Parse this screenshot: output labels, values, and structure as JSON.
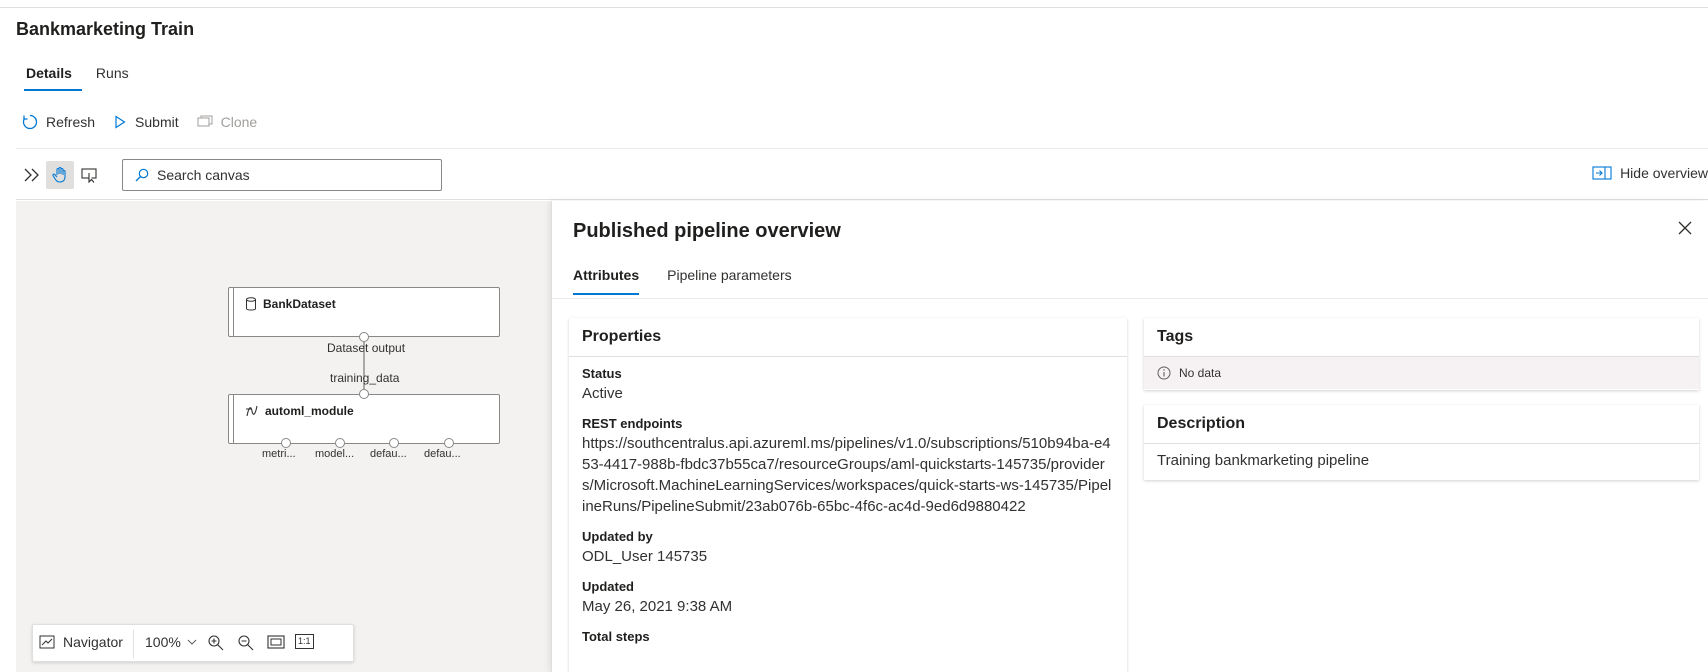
{
  "page": {
    "title": "Bankmarketing Train"
  },
  "tabs": [
    {
      "label": "Details",
      "active": true
    },
    {
      "label": "Runs",
      "active": false
    }
  ],
  "toolbar": {
    "refresh_label": "Refresh",
    "submit_label": "Submit",
    "clone_label": "Clone"
  },
  "canvas_toolbar": {
    "search_placeholder": "Search canvas",
    "hide_overview_label": "Hide overview"
  },
  "canvas": {
    "nodes": [
      {
        "title": "BankDataset",
        "icon": "database-icon",
        "output_label": "Dataset output"
      },
      {
        "title": "automl_module",
        "icon": "automl-icon",
        "input_label": "training_data",
        "output_labels": [
          "metri...",
          "model...",
          "defau...",
          "defau..."
        ]
      }
    ]
  },
  "navigator": {
    "label": "Navigator",
    "zoom": "100%",
    "actual_size_label": "1:1"
  },
  "panel": {
    "title": "Published pipeline overview",
    "tabs": [
      {
        "label": "Attributes",
        "active": true
      },
      {
        "label": "Pipeline parameters",
        "active": false
      }
    ],
    "properties": {
      "heading": "Properties",
      "status_label": "Status",
      "status_value": "Active",
      "rest_label": "REST endpoints",
      "rest_value": "https://southcentralus.api.azureml.ms/pipelines/v1.0/subscriptions/510b94ba-e453-4417-988b-fbdc37b55ca7/resourceGroups/aml-quickstarts-145735/providers/Microsoft.MachineLearningServices/workspaces/quick-starts-ws-145735/PipelineRuns/PipelineSubmit/23ab076b-65bc-4f6c-ac4d-9ed6d9880422",
      "updated_by_label": "Updated by",
      "updated_by_value": "ODL_User 145735",
      "updated_label": "Updated",
      "updated_value": "May 26, 2021 9:38 AM",
      "total_steps_label": "Total steps"
    },
    "tags": {
      "heading": "Tags",
      "empty_text": "No data"
    },
    "description": {
      "heading": "Description",
      "value": "Training bankmarketing pipeline"
    }
  },
  "colors": {
    "accent": "#0078d4",
    "canvas_bg": "#f3f2f1"
  }
}
